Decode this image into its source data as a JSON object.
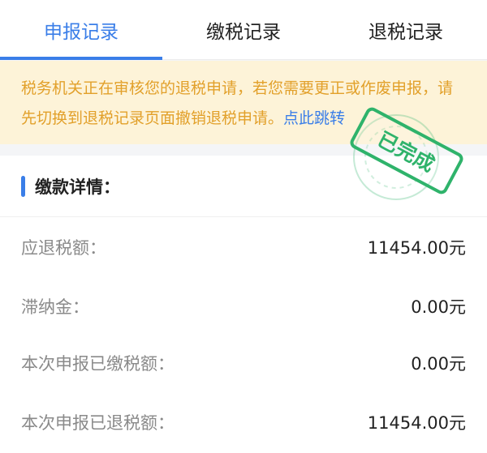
{
  "tabs": [
    {
      "label": "申报记录",
      "active": true
    },
    {
      "label": "缴税记录",
      "active": false
    },
    {
      "label": "退税记录",
      "active": false
    }
  ],
  "notice": {
    "text": "税务机关正在审核您的退税申请，若您需要更正或作废申报，请先切换到退税记录页面撤销退税申请。",
    "link": "点此跳转"
  },
  "stamp": {
    "text": "已完成"
  },
  "section": {
    "title": "缴款详情："
  },
  "details": [
    {
      "label": "应退税额：",
      "value": "11454.00元"
    },
    {
      "label": "滞纳金：",
      "value": "0.00元"
    },
    {
      "label": "本次申报已缴税额：",
      "value": "0.00元"
    },
    {
      "label": "本次申报已退税额：",
      "value": "11454.00元"
    }
  ],
  "colors": {
    "accent": "#3a7ee8",
    "notice_text": "#e2a02a",
    "notice_bg": "#fdf3d8",
    "stamp": "#2fb36b"
  }
}
